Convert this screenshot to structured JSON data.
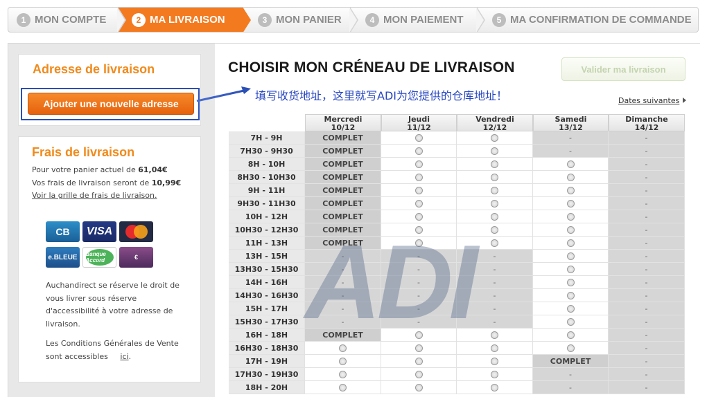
{
  "steps": [
    {
      "num": "1",
      "label": "MON COMPTE"
    },
    {
      "num": "2",
      "label": "MA LIVRAISON"
    },
    {
      "num": "3",
      "label": "MON PANIER"
    },
    {
      "num": "4",
      "label": "MON PAIEMENT"
    },
    {
      "num": "5",
      "label": "MA CONFIRMATION DE COMMANDE"
    }
  ],
  "active_step": 2,
  "sidebar": {
    "address_title": "Adresse de livraison",
    "add_address_button": "Ajouter une nouvelle adresse",
    "fees_title": "Frais de livraison",
    "cart_line_prefix": "Pour votre panier actuel de ",
    "cart_amount": "61,04€",
    "fee_line_prefix": "Vos frais de livraison seront de ",
    "fee_amount": "10,99€",
    "grid_link": "Voir la grille de frais de livraison.",
    "cards": [
      "CB",
      "VISA",
      "mastercard",
      "e-carte bleue",
      "Banque Accord",
      "AE"
    ],
    "card_labels": {
      "cb": "CB",
      "visa": "VISA",
      "ebleue": "e.BLEUE",
      "accord": "Banque Accord",
      "ae": "€"
    },
    "rights_text": "Auchandirect se réserve le droit de vous livrer sous réserve d'accessibilité à votre adresse de livraison.",
    "cgv_text": "Les Conditions Générales de Vente sont accessibles",
    "cgv_link": "ici",
    "cgv_suffix": "."
  },
  "main": {
    "title": "CHOISIR MON CRÉNEAU DE LIVRAISON",
    "validate_button": "Valider ma livraison",
    "annotation": "填写收货地址，这里就写ADI为您提供的仓库地址！",
    "next_dates": "Dates suivantes",
    "watermark": "ADI"
  },
  "schedule": {
    "days": [
      {
        "name": "Mercredi",
        "date": "10/12"
      },
      {
        "name": "Jeudi",
        "date": "11/12"
      },
      {
        "name": "Vendredi",
        "date": "12/12"
      },
      {
        "name": "Samedi",
        "date": "13/12"
      },
      {
        "name": "Dimanche",
        "date": "14/12"
      }
    ],
    "complet_label": "COMPLET",
    "closed_label": "-",
    "slots": [
      {
        "label": "7H - 9H",
        "status": [
          "complet",
          "available",
          "available",
          "closed",
          "closed"
        ]
      },
      {
        "label": "7H30 - 9H30",
        "status": [
          "complet",
          "available",
          "available",
          "closed",
          "closed"
        ]
      },
      {
        "label": "8H - 10H",
        "status": [
          "complet",
          "available",
          "available",
          "available",
          "closed"
        ]
      },
      {
        "label": "8H30 - 10H30",
        "status": [
          "complet",
          "available",
          "available",
          "available",
          "closed"
        ]
      },
      {
        "label": "9H - 11H",
        "status": [
          "complet",
          "available",
          "available",
          "available",
          "closed"
        ]
      },
      {
        "label": "9H30 - 11H30",
        "status": [
          "complet",
          "available",
          "available",
          "available",
          "closed"
        ]
      },
      {
        "label": "10H - 12H",
        "status": [
          "complet",
          "available",
          "available",
          "available",
          "closed"
        ]
      },
      {
        "label": "10H30 - 12H30",
        "status": [
          "complet",
          "available",
          "available",
          "available",
          "closed"
        ]
      },
      {
        "label": "11H - 13H",
        "status": [
          "complet",
          "available",
          "available",
          "available",
          "closed"
        ]
      },
      {
        "label": "13H - 15H",
        "status": [
          "closed",
          "closed",
          "closed",
          "available",
          "closed"
        ]
      },
      {
        "label": "13H30 - 15H30",
        "status": [
          "closed",
          "closed",
          "closed",
          "available",
          "closed"
        ]
      },
      {
        "label": "14H - 16H",
        "status": [
          "closed",
          "closed",
          "closed",
          "available",
          "closed"
        ]
      },
      {
        "label": "14H30 - 16H30",
        "status": [
          "closed",
          "closed",
          "closed",
          "available",
          "closed"
        ]
      },
      {
        "label": "15H - 17H",
        "status": [
          "closed",
          "closed",
          "closed",
          "available",
          "closed"
        ]
      },
      {
        "label": "15H30 - 17H30",
        "status": [
          "closed",
          "closed",
          "closed",
          "available",
          "closed"
        ]
      },
      {
        "label": "16H - 18H",
        "status": [
          "complet",
          "available",
          "available",
          "available",
          "closed"
        ]
      },
      {
        "label": "16H30 - 18H30",
        "status": [
          "available",
          "available",
          "available",
          "available",
          "closed"
        ]
      },
      {
        "label": "17H - 19H",
        "status": [
          "available",
          "available",
          "available",
          "complet",
          "closed"
        ]
      },
      {
        "label": "17H30 - 19H30",
        "status": [
          "available",
          "available",
          "available",
          "closed",
          "closed"
        ]
      },
      {
        "label": "18H - 20H",
        "status": [
          "available",
          "available",
          "available",
          "closed",
          "closed"
        ]
      }
    ]
  }
}
